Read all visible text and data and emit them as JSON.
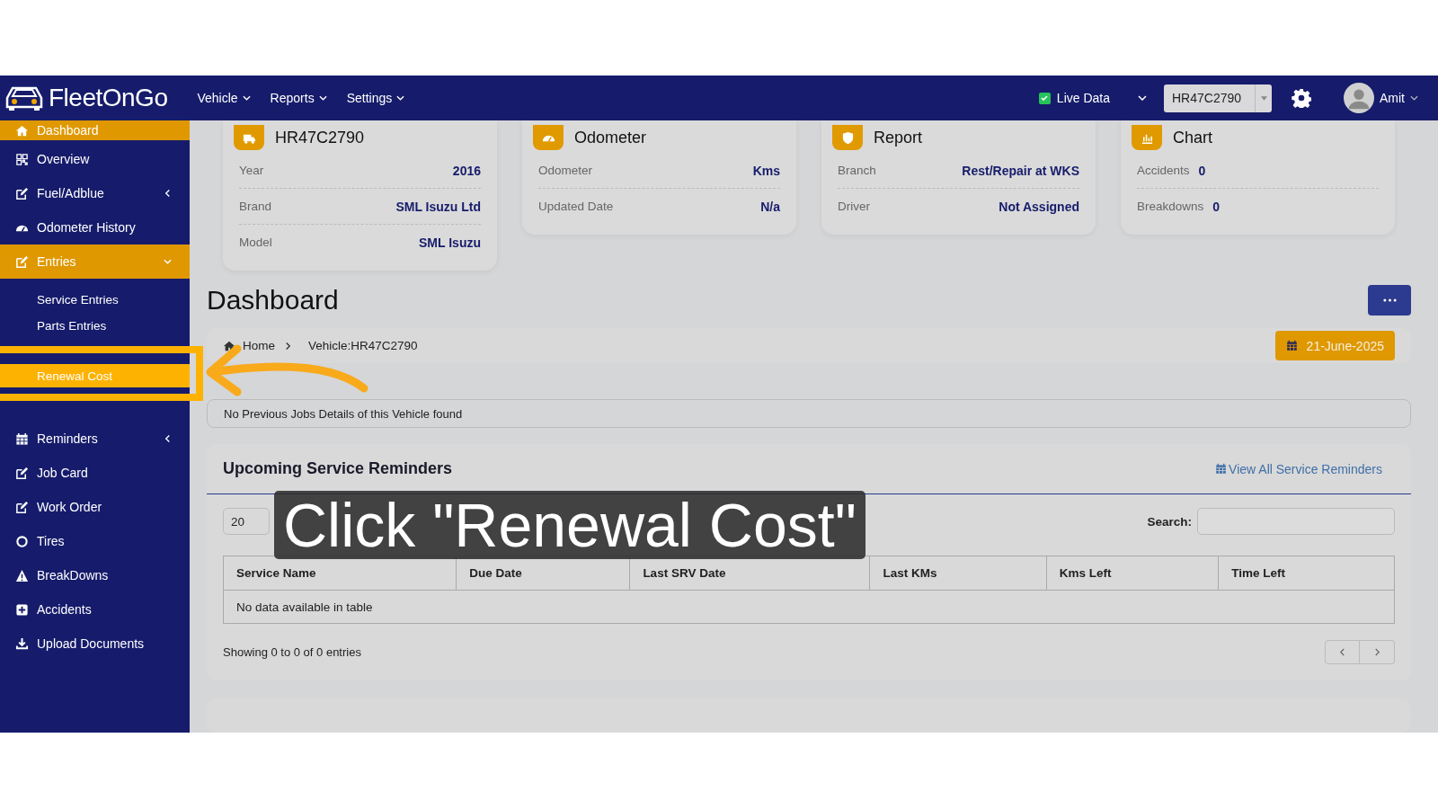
{
  "topbar": {
    "logo": "FleetOnGo",
    "menus": [
      {
        "label": "Vehicle"
      },
      {
        "label": "Reports"
      },
      {
        "label": "Settings"
      }
    ],
    "live_data": {
      "label": "Live Data",
      "checked": true
    },
    "vehicle_select": {
      "value": "HR47C2790"
    },
    "user": {
      "name": "Amit"
    }
  },
  "sidebar": {
    "items": [
      {
        "kind": "link",
        "label": "Dashboard",
        "selected": true
      },
      {
        "kind": "link",
        "label": "Overview",
        "selected": false
      },
      {
        "kind": "group",
        "label": "Fuel/Adblue",
        "selected": false,
        "expanded": false
      },
      {
        "kind": "link",
        "label": "Odometer History",
        "selected": false
      },
      {
        "kind": "group",
        "label": "Entries",
        "selected": true,
        "expanded": true,
        "children": [
          {
            "label": "Service Entries",
            "selected": false
          },
          {
            "label": "Parts Entries",
            "selected": false
          },
          {
            "label": "Renewal Cost",
            "selected": true
          }
        ]
      },
      {
        "kind": "group",
        "label": "Reminders",
        "selected": false,
        "expanded": false
      },
      {
        "kind": "link",
        "label": "Job Card",
        "selected": false
      },
      {
        "kind": "link",
        "label": "Work Order",
        "selected": false
      },
      {
        "kind": "link",
        "label": "Tires",
        "selected": false
      },
      {
        "kind": "link",
        "label": "BreakDowns",
        "selected": false
      },
      {
        "kind": "link",
        "label": "Accidents",
        "selected": false
      },
      {
        "kind": "link",
        "label": "Upload Documents",
        "selected": false
      }
    ]
  },
  "cards": [
    {
      "kind": "table",
      "title": "HR47C2790",
      "rows": [
        {
          "label": "Year",
          "value": "2016"
        },
        {
          "label": "Brand",
          "value": "SML Isuzu Ltd"
        },
        {
          "label": "Model",
          "value": "SML Isuzu"
        }
      ]
    },
    {
      "kind": "table",
      "title": "Odometer",
      "rows": [
        {
          "label": "Odometer",
          "value": "Kms"
        },
        {
          "label": "Updated Date",
          "value": "N/a"
        }
      ]
    },
    {
      "kind": "table",
      "title": "Report",
      "rows": [
        {
          "label": "Branch",
          "value": "Rest/Repair at WKS"
        },
        {
          "label": "Driver",
          "value": "Not Assigned"
        }
      ]
    },
    {
      "kind": "inline",
      "title": "Chart",
      "rows": [
        {
          "label": "Accidents",
          "value": "0"
        },
        {
          "label": "Breakdowns",
          "value": "0"
        }
      ]
    }
  ],
  "page": {
    "title": "Dashboard",
    "breadcrumb": [
      {
        "label": "Home"
      },
      {
        "label": "Vehicle:HR47C2790"
      }
    ],
    "date": "21-June-2025",
    "notice": "No Previous Jobs Details of this Vehicle found"
  },
  "reminders": {
    "title": "Upcoming Service Reminders",
    "link": "View All Service Reminders",
    "page_length": "20",
    "search_label": "Search:",
    "columns": [
      "Service Name",
      "Due Date",
      "Last SRV Date",
      "Last KMs",
      "Kms Left",
      "Time Left"
    ],
    "empty": "No data available in table",
    "info": "Showing 0 to 0 of 0 entries"
  },
  "overlay": {
    "caption": "Click \"Renewal Cost\""
  }
}
